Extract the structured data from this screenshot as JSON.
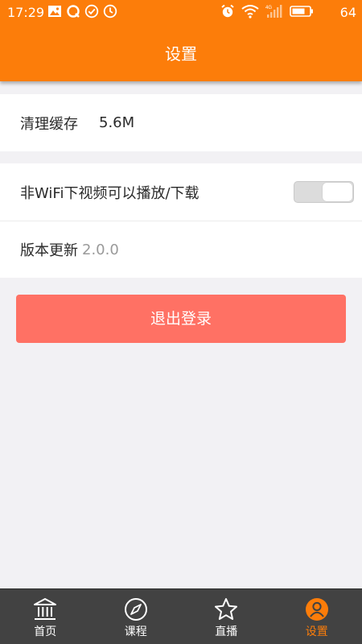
{
  "status_bar": {
    "time": "17:29",
    "battery_percent": "64",
    "network_type": "4G",
    "left_icons": [
      "image-icon",
      "q-app-icon",
      "check-circle-icon",
      "clock-circle-icon"
    ],
    "right_icons": [
      "alarm-icon",
      "wifi-icon",
      "cellular-signal-icon",
      "battery-icon"
    ]
  },
  "header": {
    "title": "设置",
    "background_color": "#fc7d0a"
  },
  "settings": {
    "cache": {
      "label": "清理缓存",
      "value": "5.6M"
    },
    "wifi_only": {
      "label": "非WiFi下视频可以播放/下载",
      "enabled": false
    },
    "version": {
      "label": "版本更新",
      "value": "2.0.0"
    }
  },
  "logout_button": {
    "label": "退出登录",
    "color": "#ff7164"
  },
  "tabbar": {
    "active_color": "#fc7d0a",
    "background_color": "#424242",
    "tabs": [
      {
        "label": "首页",
        "icon": "home-icon",
        "active": false
      },
      {
        "label": "课程",
        "icon": "compass-icon",
        "active": false
      },
      {
        "label": "直播",
        "icon": "star-icon",
        "active": false
      },
      {
        "label": "设置",
        "icon": "user-icon",
        "active": true
      }
    ]
  }
}
